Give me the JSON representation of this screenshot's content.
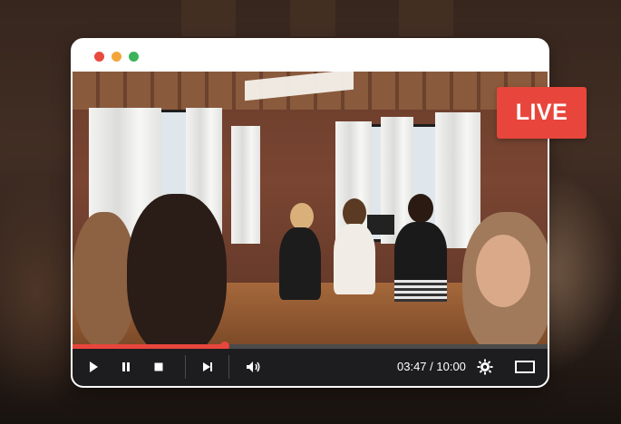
{
  "badge": {
    "label": "LIVE",
    "color": "#e8463c"
  },
  "player": {
    "progress_fraction": 0.32,
    "time_display": "03:47 / 10:00",
    "controls": [
      "play-icon",
      "pause-icon",
      "stop-icon",
      "skip-next-icon",
      "volume-icon",
      "gear-icon",
      "fullscreen-icon"
    ],
    "window_dots": [
      "#e94a3f",
      "#f2a63a",
      "#3cb35a"
    ]
  }
}
